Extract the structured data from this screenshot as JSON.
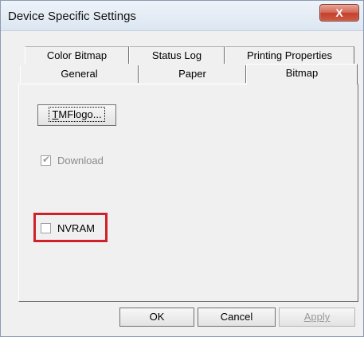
{
  "window": {
    "title": "Device Specific Settings",
    "close_glyph": "X"
  },
  "tabs": {
    "back_row": [
      "Color Bitmap",
      "Status Log",
      "Printing Properties"
    ],
    "front_row": [
      "General",
      "Paper",
      "Bitmap"
    ],
    "selected": "Bitmap"
  },
  "bitmap_page": {
    "tmflogo_button_prefix": "",
    "tmflogo_button_mnemonic": "T",
    "tmflogo_button_rest": "MFlogo...",
    "download_label": "Download",
    "download_checked": true,
    "download_disabled": true,
    "nvram_label": "NVRAM",
    "nvram_checked": false
  },
  "footer": {
    "ok_label": "OK",
    "cancel_label": "Cancel",
    "apply_label": "Apply"
  },
  "colors": {
    "highlight": "#d0202a",
    "close_button": "#c4402d"
  }
}
